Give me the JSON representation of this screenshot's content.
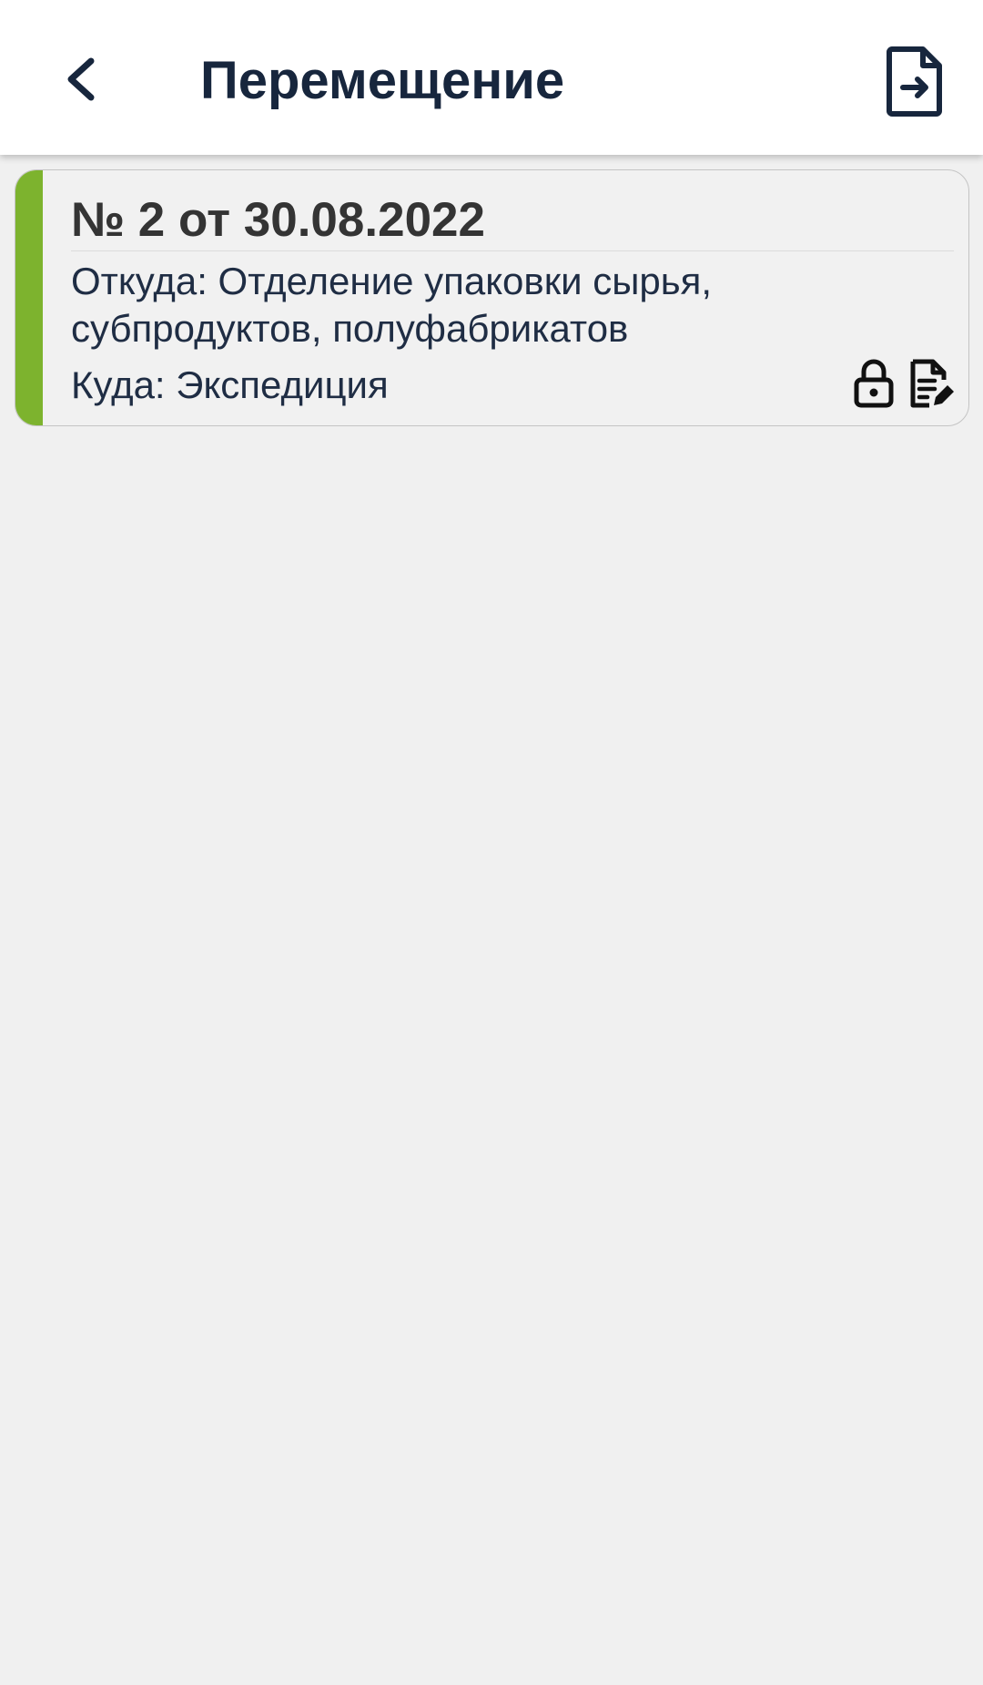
{
  "header": {
    "title": "Перемещение",
    "back_icon": "chevron-left-icon",
    "export_icon": "file-export-icon"
  },
  "documents": [
    {
      "title": "№ 2 от 30.08.2022",
      "from": "Откуда: Отделение упаковки сырья, субпродуктов, полуфабрикатов",
      "to": "Куда: Экспедиция",
      "status_color": "#7db32e",
      "icons": [
        "lock-icon",
        "file-edit-icon"
      ]
    }
  ],
  "colors": {
    "title_text": "#17263d",
    "card_title_text": "#343434",
    "body_text": "#1f2d44",
    "background": "#f0f0f0",
    "header_background": "#ffffff",
    "icon_color": "#111111"
  }
}
